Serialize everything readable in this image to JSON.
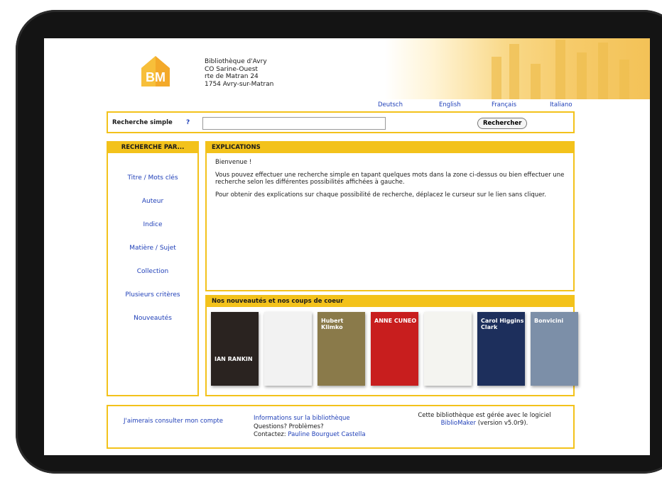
{
  "library": {
    "logo_text": "BM",
    "address_lines": [
      "Bibliothèque d'Avry",
      "CO Sarine-Ouest",
      "rte de Matran 24",
      "1754 Avry-sur-Matran"
    ]
  },
  "languages": [
    "Deutsch",
    "English",
    "Français",
    "Italiano"
  ],
  "search": {
    "label": "Recherche simple",
    "help": "?",
    "value": "",
    "button": "Rechercher"
  },
  "sidebar": {
    "title": "RECHERCHE PAR...",
    "items": [
      "Titre / Mots clés",
      "Auteur",
      "Indice",
      "Matière / Sujet",
      "Collection",
      "Plusieurs critères",
      "Nouveautés"
    ]
  },
  "explanations": {
    "title": "EXPLICATIONS",
    "welcome": "Bienvenue !",
    "p1": "Vous pouvez effectuer une recherche simple en tapant quelques mots dans la zone ci-dessus ou bien effectuer une recherche selon les différentes possibilités affichées à gauche.",
    "p2": "Pour obtenir des explications sur chaque possibilité de recherche, déplacez le curseur sur le lien sans cliquer."
  },
  "new_books": {
    "title": "Nos nouveautés et nos coups de coeur",
    "covers": [
      {
        "text": "IAN RANKIN",
        "bg": "#2a2320",
        "fg": "#ffffff"
      },
      {
        "text": "",
        "bg": "#f2f2f2",
        "fg": "#333333"
      },
      {
        "text": "Hubert Klimko",
        "bg": "#8a7a4a",
        "fg": "#ffffff"
      },
      {
        "text": "ANNE CUNEO",
        "bg": "#c81e1e",
        "fg": "#ffffff"
      },
      {
        "text": "",
        "bg": "#f4f4f0",
        "fg": "#333333"
      },
      {
        "text": "Carol Higgins Clark",
        "bg": "#1d2f5c",
        "fg": "#ffffff"
      },
      {
        "text": "Bonvicini",
        "bg": "#7c8fa8",
        "fg": "#ffffff"
      }
    ]
  },
  "footer": {
    "account": "J'aimerais consulter mon compte",
    "info": "Informations sur la bibliothèque",
    "questions": "Questions? Problèmes?",
    "contact_prefix": "Contactez:",
    "contact_name": "Pauline Bourguet Castella",
    "managed_line1": "Cette bibliothèque est gérée avec le logiciel",
    "managed_link": "BiblioMaker",
    "managed_version": "(version v5.0r9)."
  },
  "colors": {
    "accent": "#f3c21b",
    "link": "#1f3fb8"
  }
}
